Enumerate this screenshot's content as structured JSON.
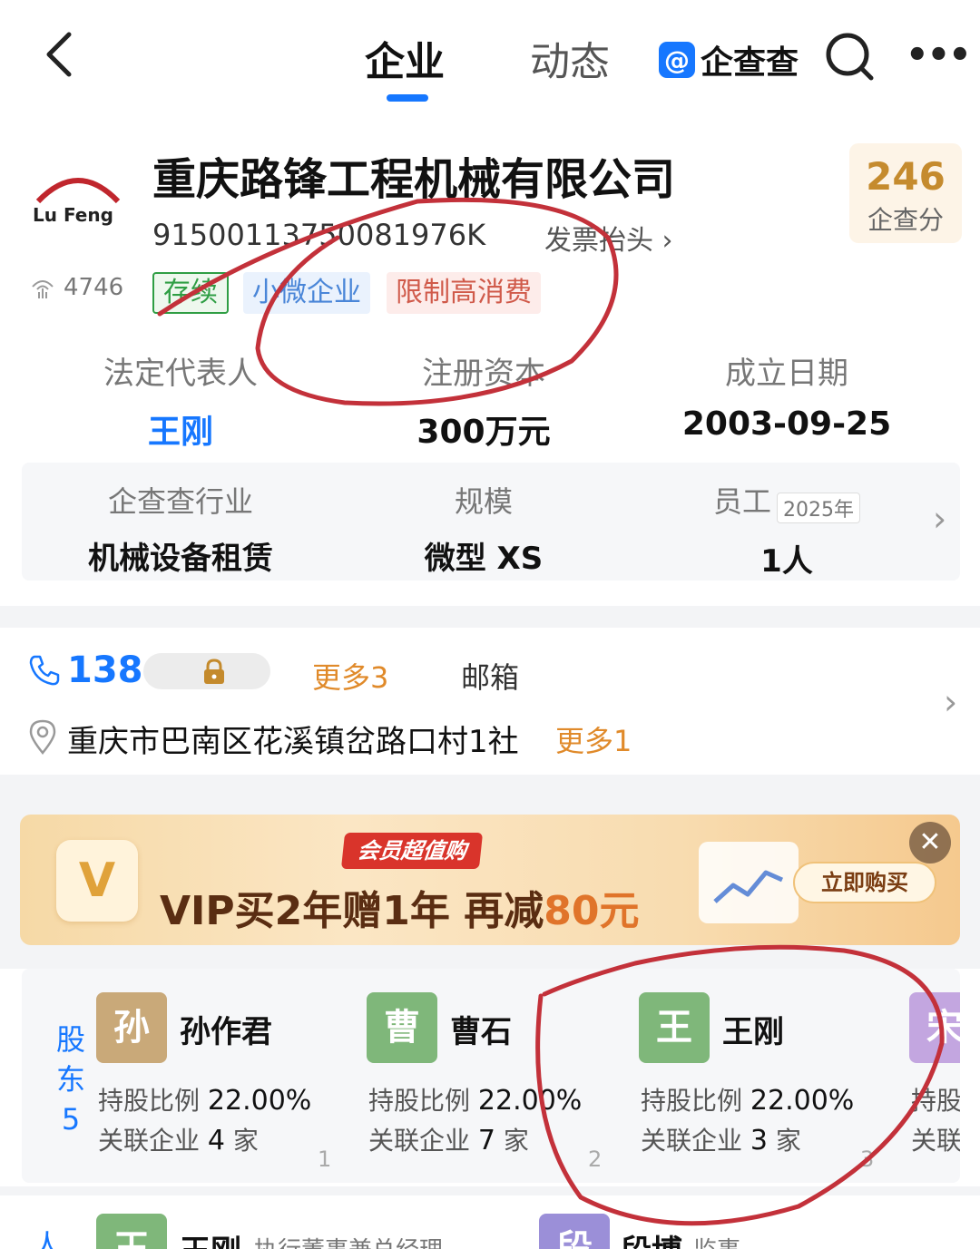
{
  "nav": {
    "tabs": [
      {
        "label": "企业"
      },
      {
        "label": "动态"
      }
    ],
    "brand_mark": "@",
    "brand_name": "企查查",
    "more": "•••"
  },
  "company": {
    "logo_text": "Lu Feng",
    "name": "重庆路锋工程机械有限公司",
    "credit_code": "91500113750081976K",
    "invoice_link": "发票抬头",
    "score_value": "246",
    "score_label": "企查分",
    "views": "4746",
    "tags": {
      "status": "存续",
      "size": "小微企业",
      "restrict": "限制高消费"
    }
  },
  "info": {
    "legal_rep_label": "法定代表人",
    "legal_rep_value": "王刚",
    "capital_label": "注册资本",
    "capital_value": "300万元",
    "founded_label": "成立日期",
    "founded_value": "2003-09-25"
  },
  "industry": {
    "industry_label": "企查查行业",
    "industry_value": "机械设备租赁",
    "scale_label": "规模",
    "scale_value": "微型 XS",
    "staff_label": "员工",
    "staff_year": "2025年",
    "staff_value": "1人"
  },
  "contact": {
    "phone": "138",
    "more_phone": "更多3",
    "email": "邮箱",
    "address": "重庆市巴南区花溪镇岔路口村1社",
    "more_addr": "更多1"
  },
  "banner": {
    "badge": "会员超值购",
    "headline_part1": "VIP买2年赠1年  再减",
    "headline_price": "80元",
    "buy_label": "立即购买",
    "close": "✕",
    "v_mark": "V"
  },
  "shareholders": {
    "label": "股东",
    "count": "5",
    "ratio_label": "持股比例",
    "related_label": "关联企业",
    "related_unit": "家",
    "people": [
      {
        "avatar": "孙",
        "name": "孙作君",
        "ratio": "22.00%",
        "related": "4",
        "index": "1",
        "color": "#c9a979"
      },
      {
        "avatar": "曹",
        "name": "曹石",
        "ratio": "22.00%",
        "related": "7",
        "index": "2",
        "color": "#7fb77a"
      },
      {
        "avatar": "王",
        "name": "王刚",
        "ratio": "22.00%",
        "related": "3",
        "index": "3",
        "color": "#7fb77a"
      },
      {
        "avatar": "宋",
        "name": "",
        "ratio": "",
        "related": "",
        "index": "",
        "color": "#c3a6e0"
      }
    ]
  },
  "personnel": {
    "label": "人",
    "people": [
      {
        "avatar": "王",
        "name": "王刚",
        "role": "执行董事兼总经理",
        "color": "#7fb77a"
      },
      {
        "avatar": "段",
        "name": "段博",
        "role": "监事",
        "color": "#9b8fd8"
      }
    ]
  },
  "colors": {
    "accent": "#1677ff",
    "annotation": "#c3313a",
    "score": "#c58b2e",
    "more_link": "#e08a2a"
  }
}
